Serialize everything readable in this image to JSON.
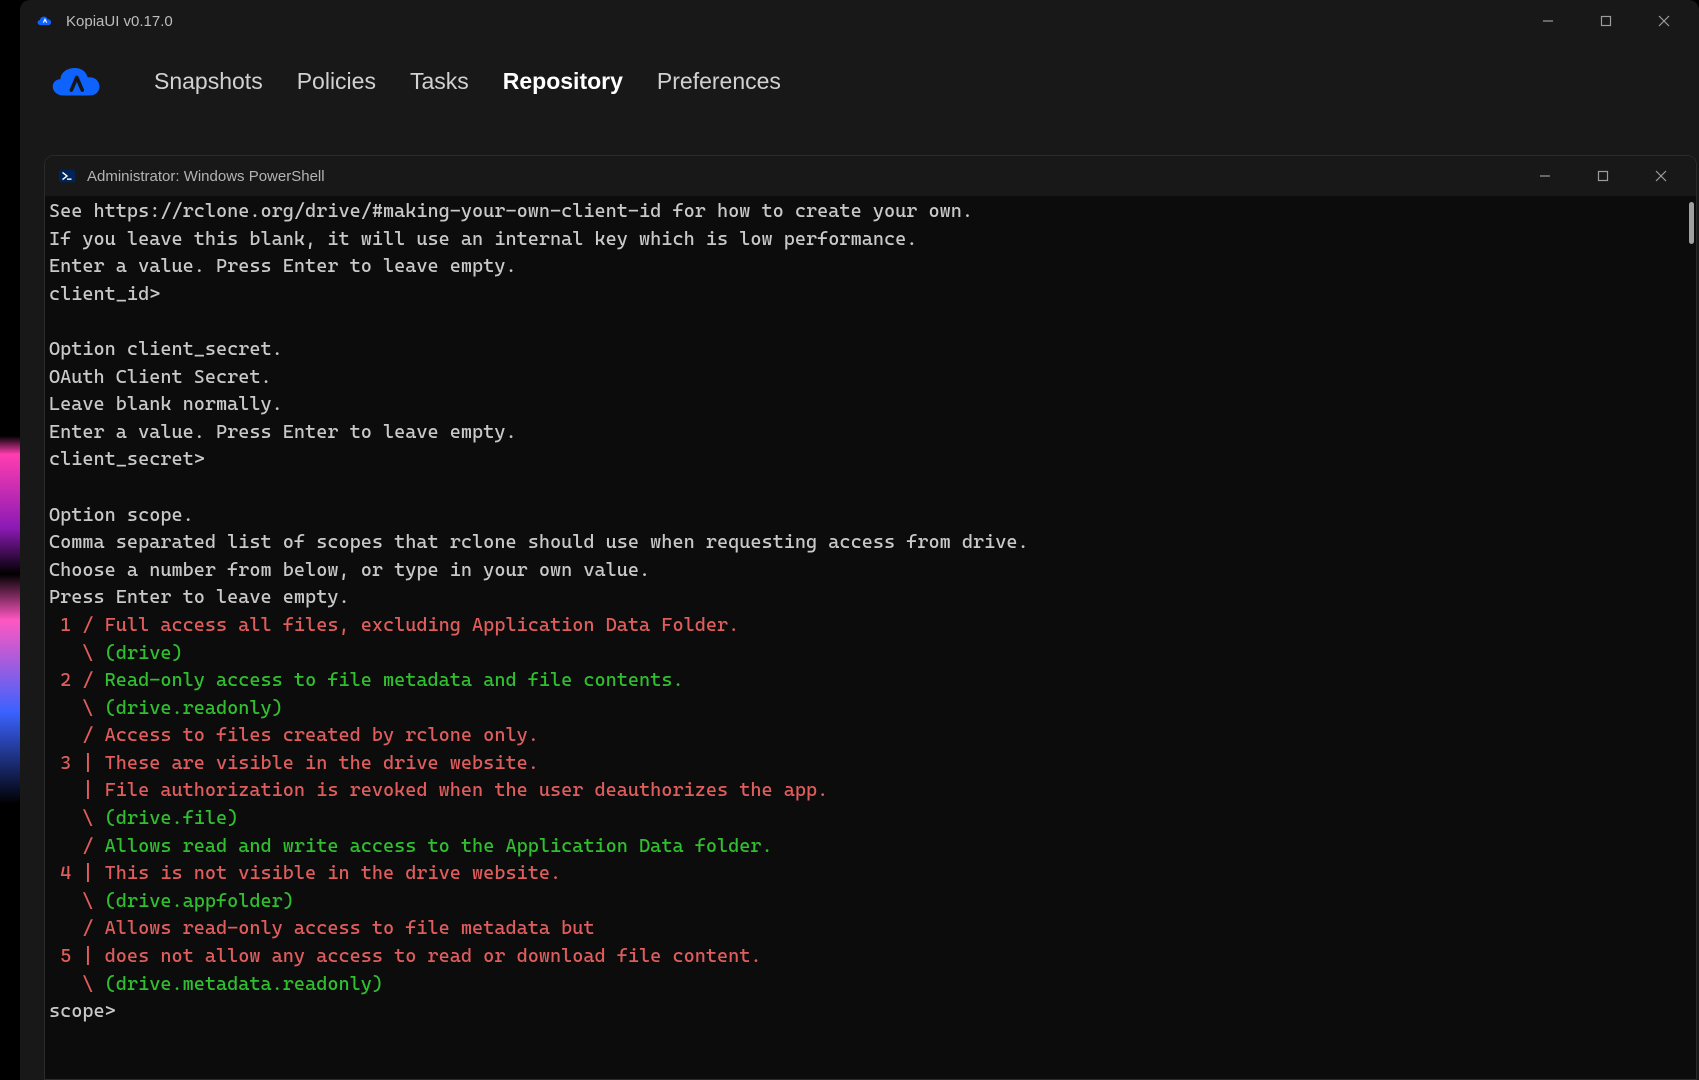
{
  "kopia": {
    "title": "KopiaUI v0.17.0",
    "nav": {
      "snapshots": "Snapshots",
      "policies": "Policies",
      "tasks": "Tasks",
      "repository": "Repository",
      "preferences": "Preferences",
      "active": "repository"
    }
  },
  "powershell": {
    "title": "Administrator: Windows PowerShell",
    "lines": [
      {
        "t": "See https://rclone.org/drive/#making-your-own-client-id for how to create your own."
      },
      {
        "t": "If you leave this blank, it will use an internal key which is low performance."
      },
      {
        "t": "Enter a value. Press Enter to leave empty."
      },
      {
        "t": "client_id>"
      },
      {
        "t": ""
      },
      {
        "t": "Option client_secret."
      },
      {
        "t": "OAuth Client Secret."
      },
      {
        "t": "Leave blank normally."
      },
      {
        "t": "Enter a value. Press Enter to leave empty."
      },
      {
        "t": "client_secret>"
      },
      {
        "t": ""
      },
      {
        "t": "Option scope."
      },
      {
        "t": "Comma separated list of scopes that rclone should use when requesting access from drive."
      },
      {
        "t": "Choose a number from below, or type in your own value."
      },
      {
        "t": "Press Enter to leave empty."
      },
      {
        "segs": [
          {
            "c": "red",
            "t": " 1 / Full access all files, excluding Application Data Folder."
          }
        ]
      },
      {
        "segs": [
          {
            "c": "red",
            "t": "   \\ "
          },
          {
            "c": "green",
            "t": "(drive)"
          }
        ]
      },
      {
        "segs": [
          {
            "c": "red",
            "t": " 2 / "
          },
          {
            "c": "green",
            "t": "Read-only access to file metadata and file contents."
          }
        ]
      },
      {
        "segs": [
          {
            "c": "red",
            "t": "   \\ "
          },
          {
            "c": "green",
            "t": "(drive.readonly)"
          }
        ]
      },
      {
        "segs": [
          {
            "c": "red",
            "t": "   / Access to files created by rclone only."
          }
        ]
      },
      {
        "segs": [
          {
            "c": "red",
            "t": " 3 | These are visible in the drive website."
          }
        ]
      },
      {
        "segs": [
          {
            "c": "red",
            "t": "   | File authorization is revoked when the user deauthorizes the app."
          }
        ]
      },
      {
        "segs": [
          {
            "c": "red",
            "t": "   \\ "
          },
          {
            "c": "green",
            "t": "(drive.file)"
          }
        ]
      },
      {
        "segs": [
          {
            "c": "red",
            "t": "   / "
          },
          {
            "c": "green",
            "t": "Allows read and write access to the Application Data folder."
          }
        ]
      },
      {
        "segs": [
          {
            "c": "red",
            "t": " 4 | This is not visible in the drive website."
          }
        ]
      },
      {
        "segs": [
          {
            "c": "red",
            "t": "   \\ "
          },
          {
            "c": "green",
            "t": "(drive.appfolder)"
          }
        ]
      },
      {
        "segs": [
          {
            "c": "red",
            "t": "   / Allows read-only access to file metadata but"
          }
        ]
      },
      {
        "segs": [
          {
            "c": "red",
            "t": " 5 | does not allow any access to read or download file content."
          }
        ]
      },
      {
        "segs": [
          {
            "c": "red",
            "t": "   \\ "
          },
          {
            "c": "green",
            "t": "(drive.metadata.readonly)"
          }
        ]
      },
      {
        "t": "scope>"
      }
    ]
  }
}
